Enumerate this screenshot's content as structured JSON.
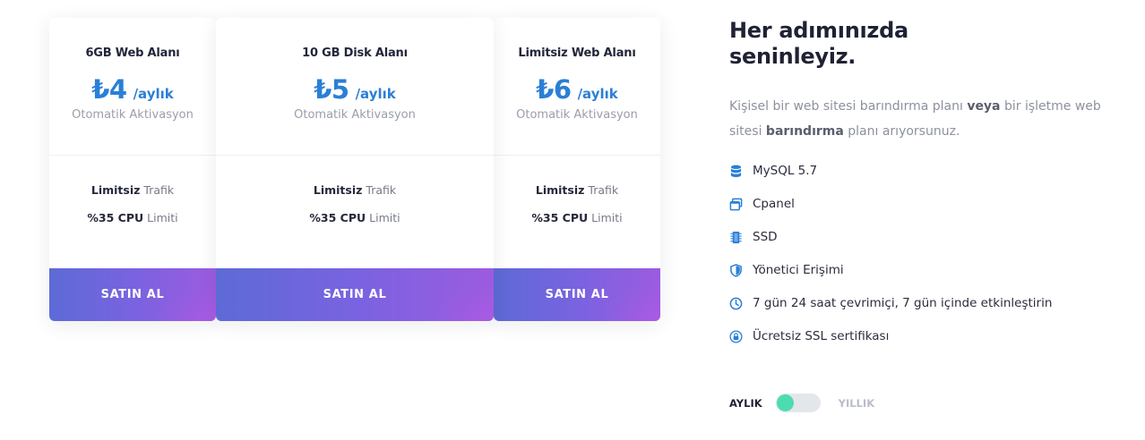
{
  "plans": [
    {
      "title": "6GB Web Alanı",
      "price": "₺4",
      "period": "/aylık",
      "activation": "Otomatik Aktivasyon",
      "features": [
        {
          "bold": "Limitsiz",
          "rest": " Trafik"
        },
        {
          "bold": "%35 CPU",
          "rest": " Limiti"
        }
      ],
      "button": "SATIN AL"
    },
    {
      "title": "10 GB Disk Alanı",
      "price": "₺5",
      "period": "/aylık",
      "activation": "Otomatik Aktivasyon",
      "features": [
        {
          "bold": "Limitsiz",
          "rest": " Trafik"
        },
        {
          "bold": "%35 CPU",
          "rest": " Limiti"
        }
      ],
      "button": "SATIN AL"
    },
    {
      "title": "Limitsiz Web Alanı",
      "price": "₺6",
      "period": "/aylık",
      "activation": "Otomatik Aktivasyon",
      "features": [
        {
          "bold": "Limitsiz",
          "rest": " Trafik"
        },
        {
          "bold": "%35 CPU",
          "rest": " Limiti"
        }
      ],
      "button": "SATIN AL"
    }
  ],
  "info": {
    "heading_line1": "Her adımınızda",
    "heading_line2": "seninleyiz.",
    "desc": {
      "part1": "Kişisel bir web sitesi barındırma planı ",
      "bold1": "veya",
      "part2": " bir işletme web sitesi ",
      "bold2": "barındırma",
      "part3": " planı arıyorsunuz."
    },
    "features": [
      {
        "icon": "database-icon",
        "label": "MySQL 5.7"
      },
      {
        "icon": "windows-icon",
        "label": "Cpanel"
      },
      {
        "icon": "memory-chip-icon",
        "label": "SSD"
      },
      {
        "icon": "shield-icon",
        "label": "Yönetici Erişimi"
      },
      {
        "icon": "clock-icon",
        "label": "7 gün 24 saat çevrimiçi, 7 gün içinde etkinleştirin"
      },
      {
        "icon": "lock-icon",
        "label": "Ücretsiz SSL sertifikası"
      }
    ]
  },
  "billing_toggle": {
    "monthly_label": "AYLIK",
    "yearly_label": "YILLIK",
    "selected": "AYLIK"
  },
  "colors": {
    "accent_blue": "#2a7fd6",
    "button_gradient_start": "#5d6ad6",
    "button_gradient_end": "#9c5be0",
    "toggle_knob": "#4cdcb0"
  }
}
